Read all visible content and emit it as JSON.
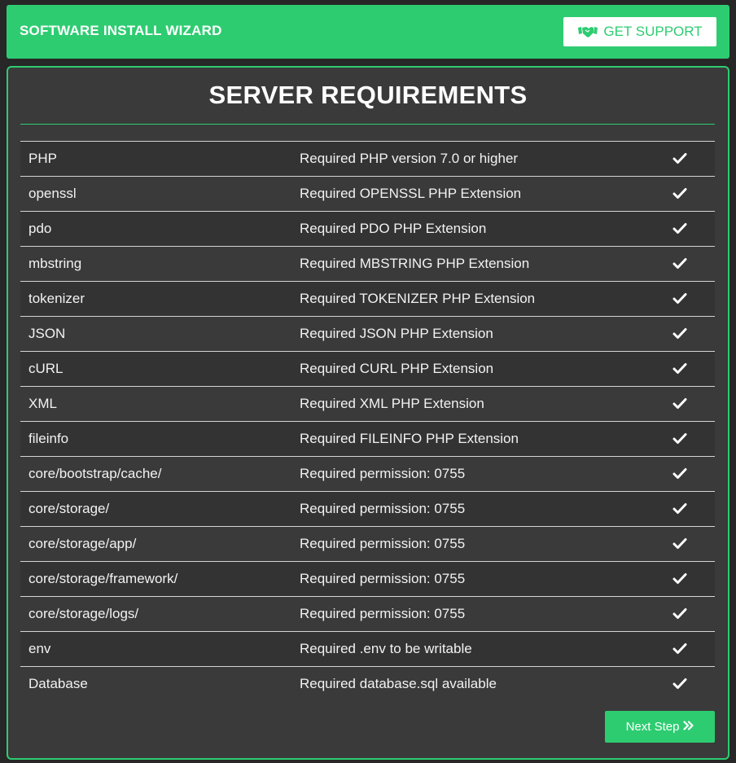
{
  "header": {
    "title": "SOFTWARE INSTALL WIZARD",
    "support_label": "GET SUPPORT",
    "support_icon": "handshake-icon"
  },
  "panel": {
    "title": "SERVER REQUIREMENTS",
    "requirements": [
      {
        "name": "PHP",
        "description": "Required PHP version 7.0 or higher",
        "status": "check"
      },
      {
        "name": "openssl",
        "description": "Required OPENSSL PHP Extension",
        "status": "check"
      },
      {
        "name": "pdo",
        "description": "Required PDO PHP Extension",
        "status": "check"
      },
      {
        "name": "mbstring",
        "description": "Required MBSTRING PHP Extension",
        "status": "check"
      },
      {
        "name": "tokenizer",
        "description": "Required TOKENIZER PHP Extension",
        "status": "check"
      },
      {
        "name": "JSON",
        "description": "Required JSON PHP Extension",
        "status": "check"
      },
      {
        "name": "cURL",
        "description": "Required CURL PHP Extension",
        "status": "check"
      },
      {
        "name": "XML",
        "description": "Required XML PHP Extension",
        "status": "check"
      },
      {
        "name": "fileinfo",
        "description": "Required FILEINFO PHP Extension",
        "status": "check"
      },
      {
        "name": "core/bootstrap/cache/",
        "description": "Required permission: 0755",
        "status": "check"
      },
      {
        "name": "core/storage/",
        "description": "Required permission: 0755",
        "status": "check"
      },
      {
        "name": "core/storage/app/",
        "description": "Required permission: 0755",
        "status": "check"
      },
      {
        "name": "core/storage/framework/",
        "description": "Required permission: 0755",
        "status": "check"
      },
      {
        "name": "core/storage/logs/",
        "description": "Required permission: 0755",
        "status": "check"
      },
      {
        "name": "env",
        "description": "Required .env to be writable",
        "status": "check"
      },
      {
        "name": "Database",
        "description": "Required database.sql available",
        "status": "check"
      }
    ],
    "next_label": "Next Step",
    "next_icon": "double-chevron-right-icon"
  },
  "colors": {
    "accent": "#2ecc71",
    "background": "#272727",
    "panel": "#3a3a3a",
    "text": "#ffffff"
  }
}
